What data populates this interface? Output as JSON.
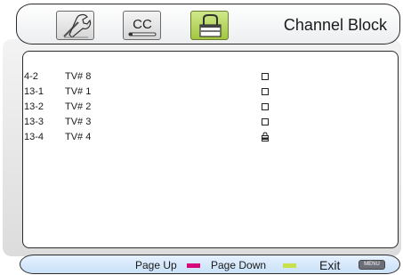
{
  "header": {
    "title": "Channel Block",
    "tabs": [
      {
        "icon": "wrench-icon",
        "active": false
      },
      {
        "icon": "cc-icon",
        "label": "CC",
        "active": false
      },
      {
        "icon": "lock-icon",
        "active": true
      }
    ]
  },
  "channels": [
    {
      "number": "4-2",
      "name": "TV# 8",
      "blocked": false
    },
    {
      "number": "13-1",
      "name": "TV# 1",
      "blocked": false
    },
    {
      "number": "13-2",
      "name": "TV# 2",
      "blocked": false
    },
    {
      "number": "13-3",
      "name": "TV# 3",
      "blocked": false
    },
    {
      "number": "13-4",
      "name": "TV# 4",
      "blocked": true
    }
  ],
  "footer": {
    "page_up_label": "Page Up",
    "page_up_color": "#d6087c",
    "page_down_label": "Page Down",
    "page_down_color": "#c8e04a",
    "exit_label": "Exit",
    "menu_key_label": "MENU"
  }
}
